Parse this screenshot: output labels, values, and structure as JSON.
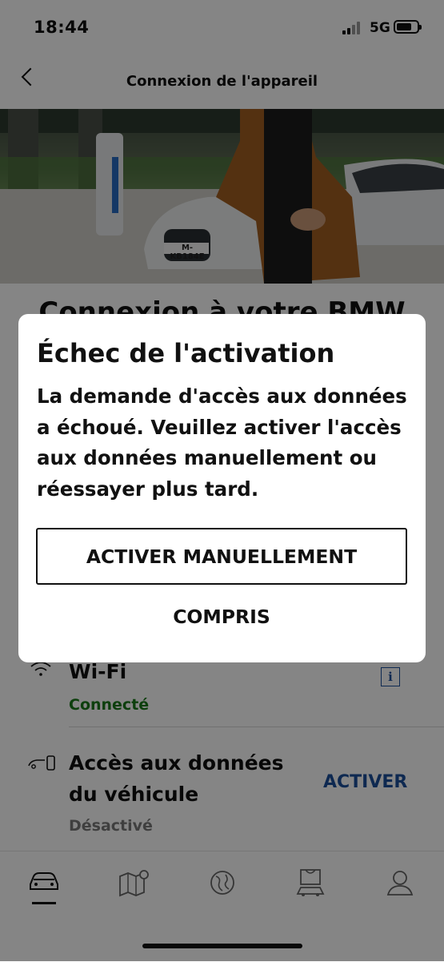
{
  "status_bar": {
    "time": "18:44",
    "network": "5G"
  },
  "header": {
    "title": "Connexion de l'appareil"
  },
  "main": {
    "heading": "Connexion à votre BMW",
    "rows": [
      {
        "title": "Wi-Fi",
        "status": "Connecté",
        "status_color": "#1a7a1a"
      },
      {
        "title_line1": "Accès aux données",
        "title_line2": "du véhicule",
        "status": "Désactivé",
        "action_label": "ACTIVER",
        "action_color": "#1c4f9c"
      }
    ]
  },
  "hero_plate": "M-KB184E",
  "tab_bar": {
    "items": [
      "car-icon",
      "map-icon",
      "globe-icon",
      "shop-icon",
      "profile-icon"
    ]
  },
  "dialog": {
    "title": "Échec de l'activation",
    "message": "La demande d'accès aux données a échoué. Veuillez activer l'accès aux données manuellement ou réessayer plus tard.",
    "primary_button": "ACTIVER MANUELLEMENT",
    "secondary_button": "COMPRIS"
  }
}
